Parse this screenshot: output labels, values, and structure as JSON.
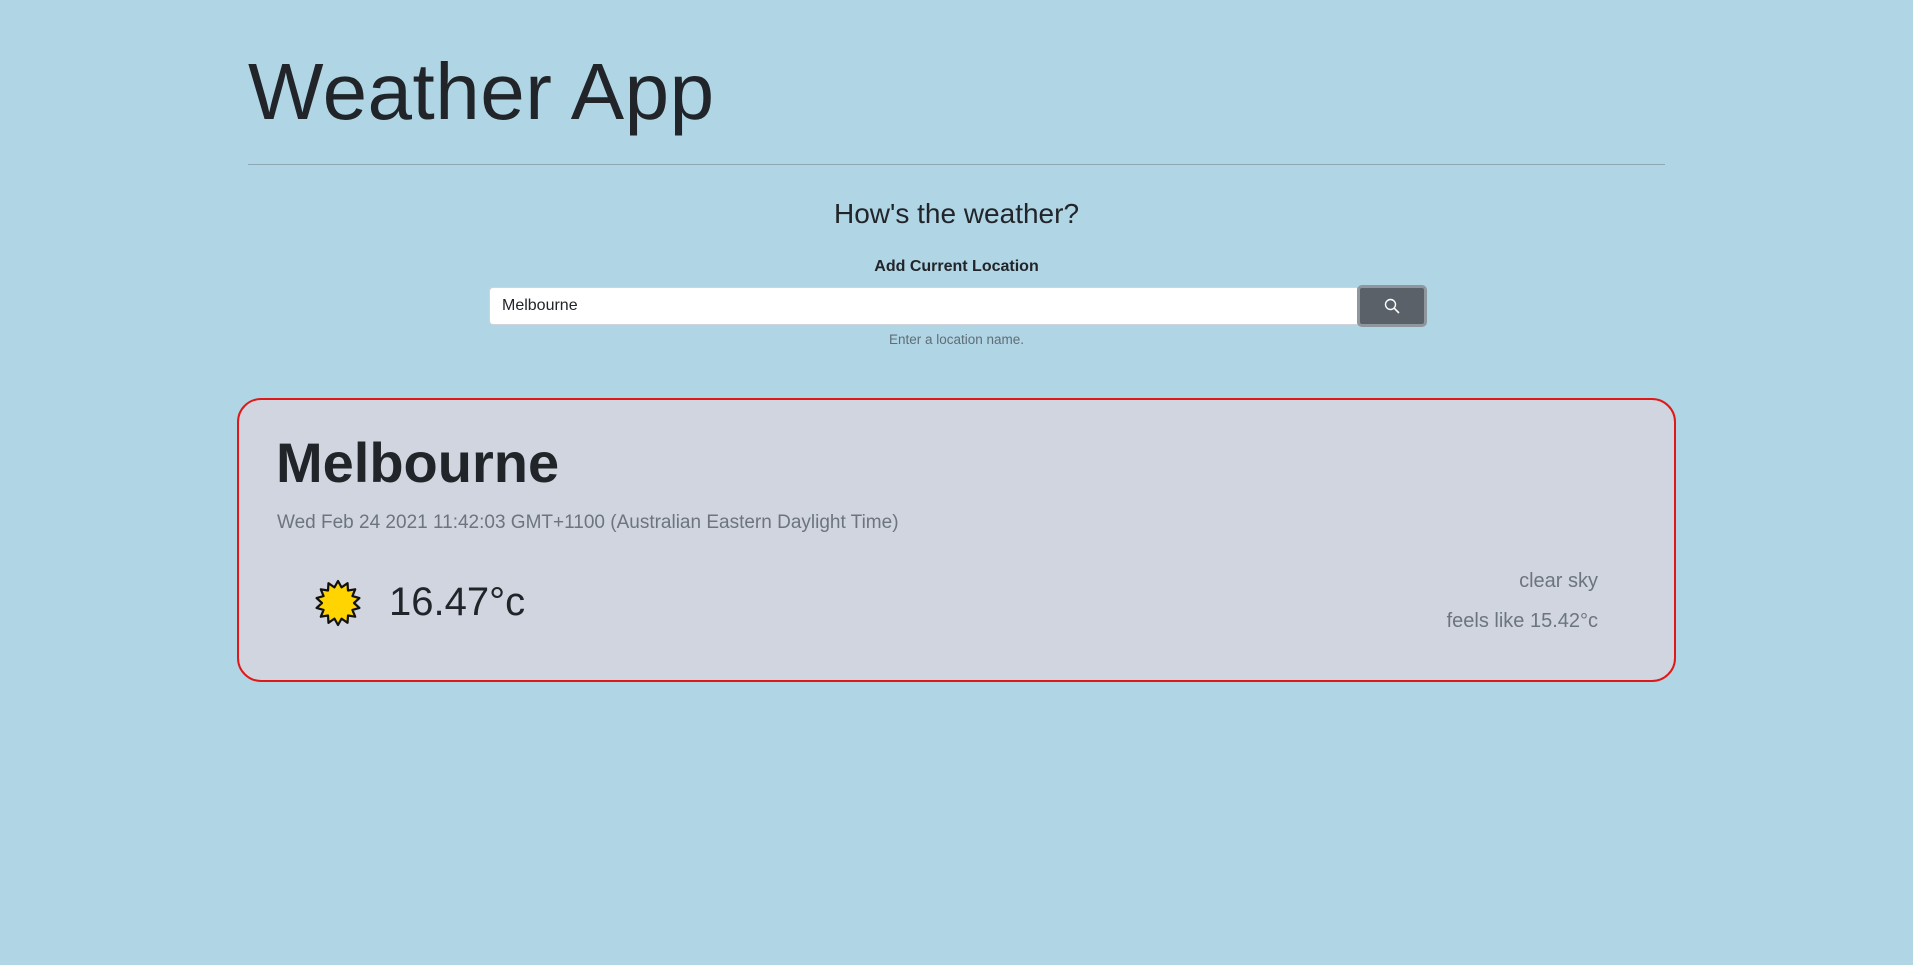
{
  "header": {
    "title": "Weather App"
  },
  "search": {
    "heading": "How's the weather?",
    "label": "Add Current Location",
    "value": "Melbourne",
    "helper": "Enter a location name.",
    "button_icon": "search-icon"
  },
  "weather": {
    "city": "Melbourne",
    "datetime": "Wed Feb 24 2021 11:42:03 GMT+1100 (Australian Eastern Daylight Time)",
    "icon": "sun-icon",
    "temperature": "16.47°c",
    "description": "clear sky",
    "feels_like": "feels like 15.42°c"
  },
  "colors": {
    "background": "#b0d5e5",
    "card_background": "#d1d5e0",
    "card_border": "#e01818",
    "button": "#5a6169",
    "sun_fill": "#ffd400"
  }
}
